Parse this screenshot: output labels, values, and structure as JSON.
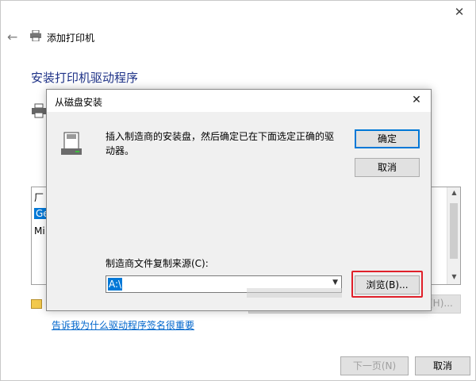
{
  "wizard": {
    "title": "添加打印机",
    "heading": "安装打印机驱动程序",
    "back_icon": "back-arrow-icon",
    "close_icon": "close-icon",
    "behind_list": {
      "rows": [
        "厂",
        "Ge",
        "Mi"
      ]
    },
    "signature_link": "告诉我为什么驱动程序签名很重要",
    "next_button": "下一页(N)",
    "cancel_button": "取消"
  },
  "dialog": {
    "title": "从磁盘安装",
    "instruction": "插入制造商的安装盘，然后确定已在下面选定正确的驱动器。",
    "ok_button": "确定",
    "cancel_button": "取消",
    "source_label": "制造商文件复制来源(C):",
    "source_value": "A:\\",
    "browse_button": "浏览(B)..."
  },
  "colors": {
    "accent": "#0078d7",
    "heading": "#1e3287",
    "highlight": "#e0202a",
    "link": "#0066cc"
  }
}
